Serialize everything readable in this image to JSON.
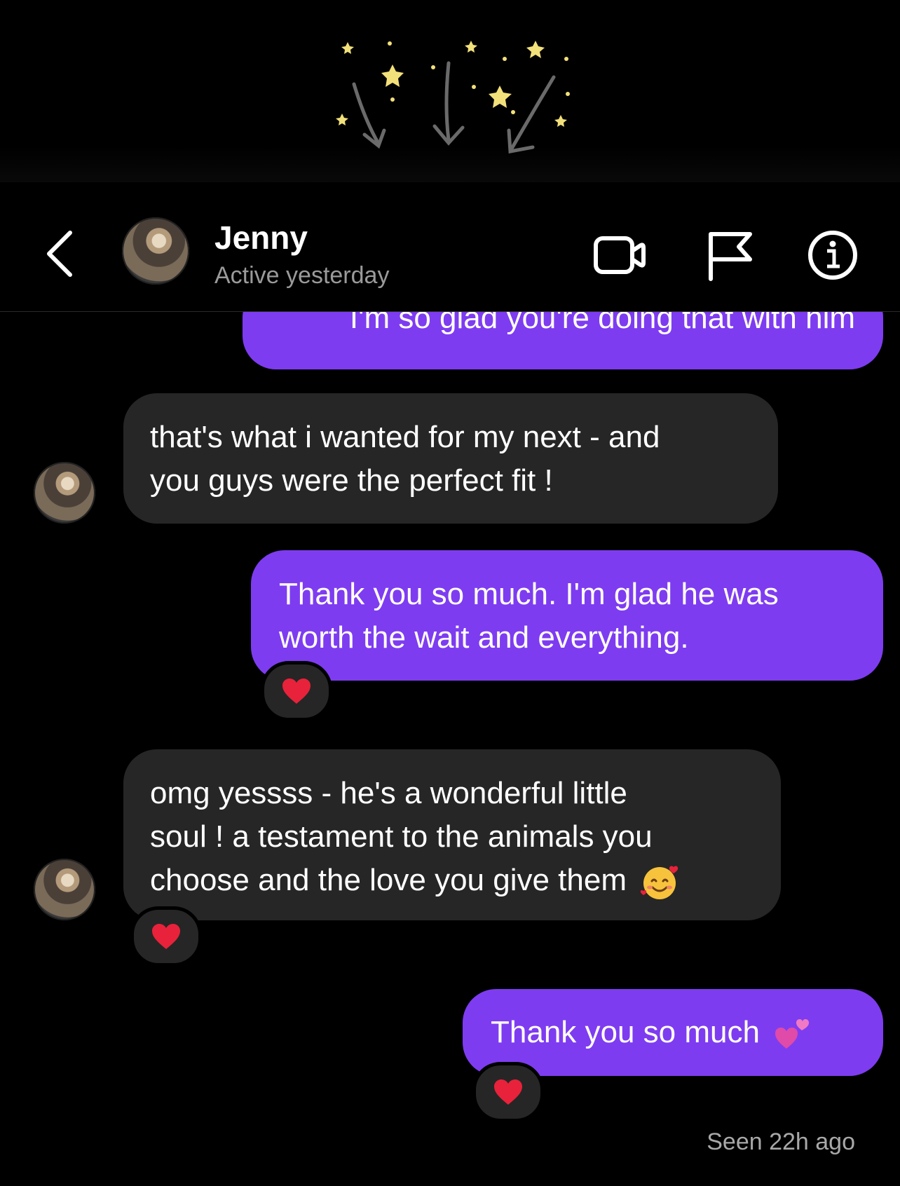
{
  "header": {
    "contact_name": "Jenny",
    "contact_status": "Active yesterday"
  },
  "messages": [
    {
      "direction": "outgoing",
      "text": "I'm so glad you're doing that with him"
    },
    {
      "direction": "incoming",
      "lines": [
        "that's what i wanted for my next - and",
        "you guys were the perfect fit !"
      ]
    },
    {
      "direction": "outgoing",
      "lines": [
        "Thank you so much. I'm glad he was",
        "worth the wait and everything."
      ],
      "reaction": "red-heart"
    },
    {
      "direction": "incoming",
      "lines": [
        "omg yessss - he's a wonderful little",
        "soul ! a testament to the animals you",
        "choose and the love you give them"
      ],
      "emoji": "smiling-face-with-hearts",
      "reaction": "red-heart"
    },
    {
      "direction": "outgoing",
      "text": "Thank you so much",
      "emoji": "two-hearts",
      "reaction": "red-heart"
    }
  ],
  "seen_status": "Seen 22h ago",
  "colors": {
    "outgoing_bubble": "#7e3cf0",
    "incoming_bubble": "#262626",
    "background": "#000000",
    "secondary_text": "#9a9a9a"
  }
}
